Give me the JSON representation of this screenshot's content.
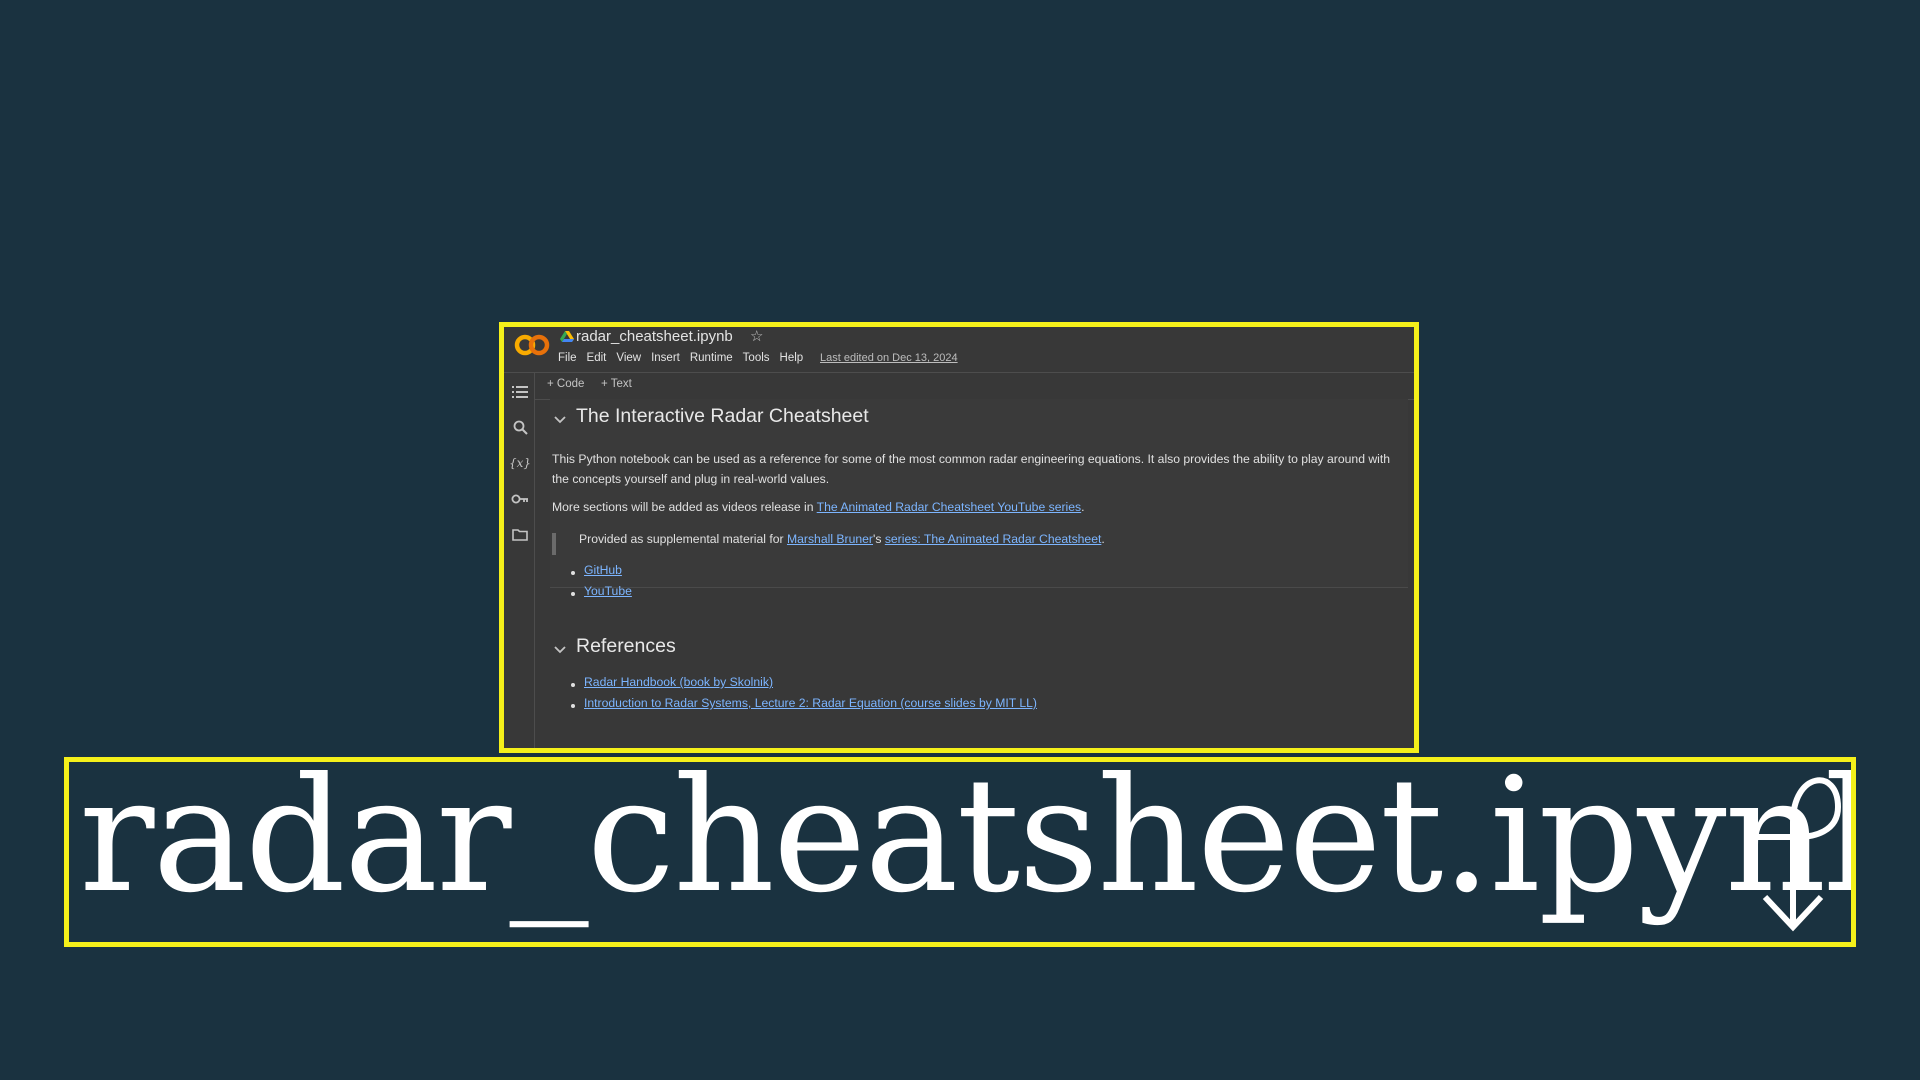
{
  "app": {
    "filename": "radar_cheatsheet.ipynb",
    "menu": [
      "File",
      "Edit",
      "View",
      "Insert",
      "Runtime",
      "Tools",
      "Help"
    ],
    "last_edited": "Last edited on Dec 13, 2024",
    "toolbar": {
      "code": "+ Code",
      "text": "+ Text"
    }
  },
  "notebook": {
    "section1": {
      "title": "The Interactive Radar Cheatsheet",
      "para1": "This Python notebook can be used as a reference for some of the most common radar engineering equations. It also provides the ability to play around with the concepts yourself and plug in real-world values.",
      "para2_prefix": "More sections will be added as videos release in ",
      "para2_link": "The Animated Radar Cheatsheet YouTube series",
      "para2_suffix": ".",
      "quote_prefix": "Provided as supplemental material for ",
      "quote_link1": "Marshall Bruner",
      "quote_mid": "'s ",
      "quote_link2": "series: The Animated Radar Cheatsheet",
      "quote_suffix": ".",
      "links": [
        "GitHub",
        "YouTube"
      ]
    },
    "section2": {
      "title": "References",
      "links": [
        "Radar Handbook (book by Skolnik)",
        "Introduction to Radar Systems, Lecture 2: Radar Equation (course slides by MIT LL)"
      ]
    }
  },
  "banner": {
    "text": "radar_cheatsheet.ipynb"
  },
  "colors": {
    "highlight": "#f5f01a",
    "background": "#1a3240",
    "link": "#7cb5ff",
    "panel": "#383838"
  },
  "icons": [
    "colab-logo-icon",
    "drive-icon",
    "star-icon",
    "toc-icon",
    "search-icon",
    "variables-icon",
    "key-icon",
    "folder-icon",
    "chevron-down-icon",
    "return-arrow-icon"
  ]
}
